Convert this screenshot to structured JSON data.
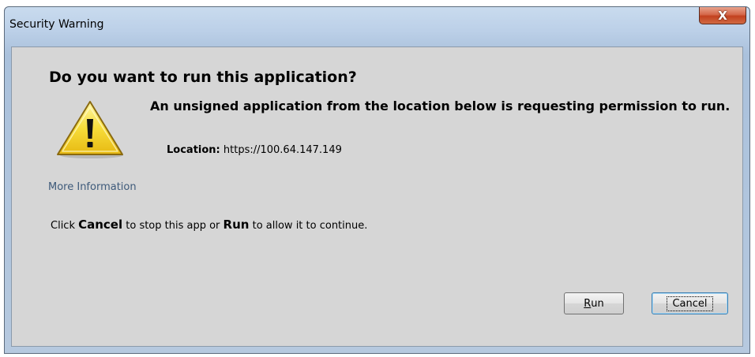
{
  "window": {
    "title": "Security Warning",
    "close_label": "X"
  },
  "dialog": {
    "heading": "Do you want to run this application?",
    "message": "An unsigned application from the location below is requesting permission to run.",
    "location_label": "Location:",
    "location_value": "https://100.64.147.149",
    "more_info_link": "More Information",
    "instruction": {
      "part1": "Click ",
      "cancel_word": "Cancel",
      "part2": " to stop this app or ",
      "run_word": "Run",
      "part3": " to allow it to continue."
    }
  },
  "buttons": {
    "run_mnemonic": "R",
    "run_rest": "un",
    "cancel_label": "Cancel"
  },
  "icons": {
    "warning": "warning-triangle-icon",
    "close": "close-icon"
  },
  "colors": {
    "link": "#3e5a7a",
    "close_button": "#c2411f",
    "warning_yellow": "#f5d327"
  }
}
